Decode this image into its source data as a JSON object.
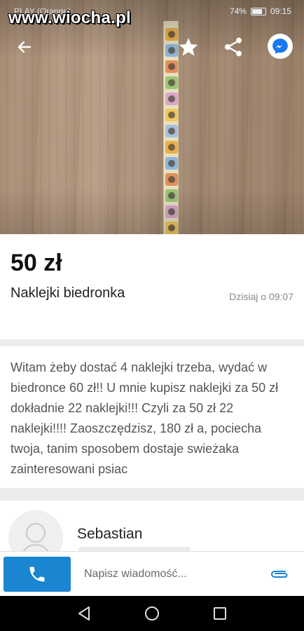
{
  "watermark": "www.wiocha.pl",
  "status": {
    "carrier": "PLAY (Orange)",
    "battery": "74%",
    "time": "09:15"
  },
  "icons": {
    "back": "arrow-left-icon",
    "favorite": "star-icon",
    "share": "share-icon",
    "messenger": "messenger-icon",
    "call": "phone-icon",
    "attach": "paperclip-icon",
    "avatar": "user-placeholder-icon",
    "nav_back": "triangle-back-icon",
    "nav_home": "circle-home-icon",
    "nav_recents": "square-recents-icon"
  },
  "listing": {
    "price": "50 zł",
    "title": "Naklejki biedronka",
    "date": "Dzisiaj o 09:07",
    "description": "Witam żeby dostać 4 naklejki trzeba, wydać w biedronce 60 zł!! U mnie kupisz naklejki za 50 zł dokładnie 22 naklejki!!! Czyli za 50 zł 22 naklejki!!!! Zaoszczędzisz, 180 zł a, pociecha twoja, tanim sposobem dostaje swieżaka zainteresowani psiac"
  },
  "seller": {
    "name": "Sebastian"
  },
  "message_bar": {
    "placeholder": "Napisz wiadomość...",
    "value": ""
  },
  "colors": {
    "accent": "#1a85d0",
    "messenger": "#1877f2",
    "background": "#ececec"
  }
}
